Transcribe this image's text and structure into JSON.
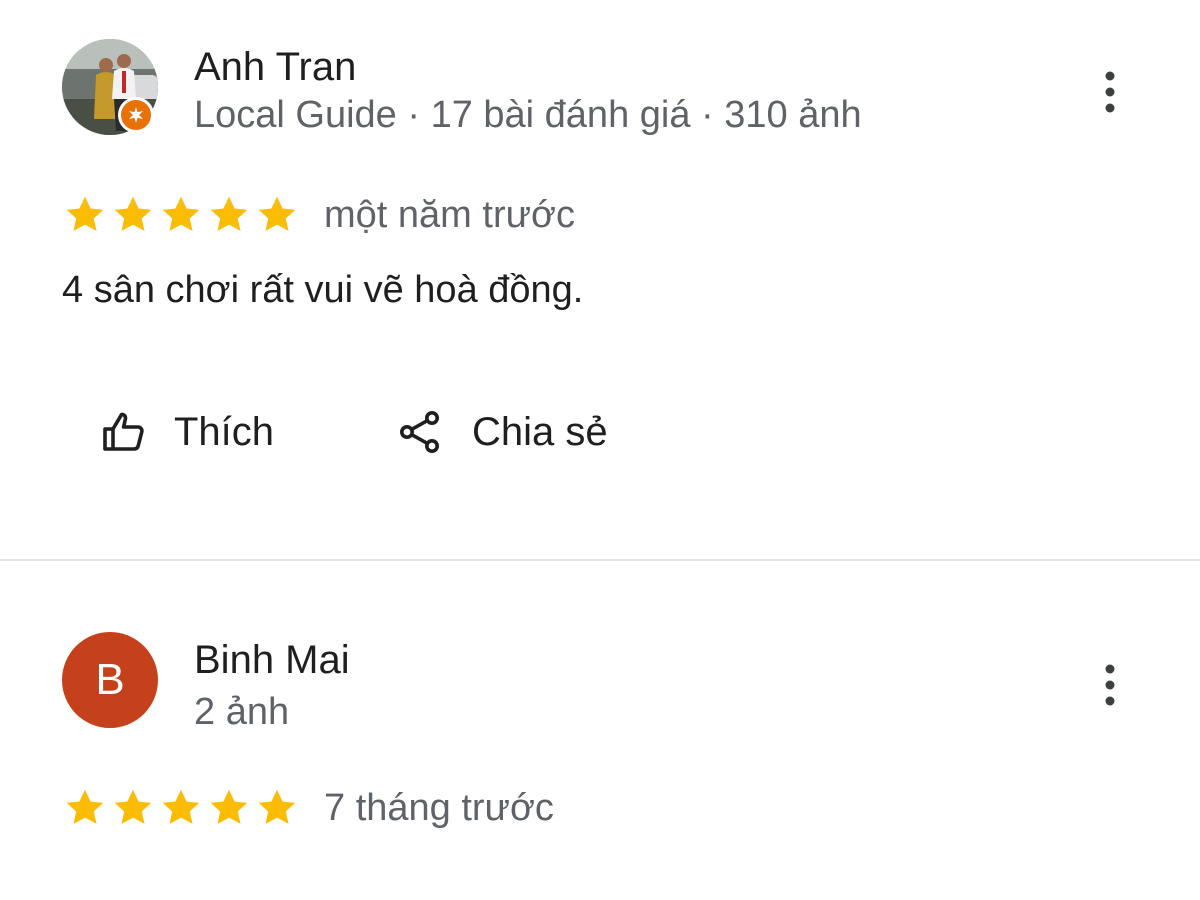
{
  "colors": {
    "star": "#fbbc04",
    "text_primary": "#1f1f1f",
    "text_secondary": "#5f6368",
    "divider": "#e3e3e3",
    "local_guide_badge": "#e8710a",
    "avatar_letter_bg": "#c5411b"
  },
  "reviews": [
    {
      "author": "Anh Tran",
      "author_meta": "Local Guide · 17 bài đánh giá · 310 ảnh",
      "avatar_type": "photo",
      "local_guide_badge": true,
      "rating": 5,
      "max_rating": 5,
      "date": "một năm trước",
      "text": "4 sân chơi rất vui vẽ hoà đồng.",
      "more_icon": "more-vert-icon",
      "actions": [
        {
          "label": "Thích",
          "icon": "thumb-up-icon"
        },
        {
          "label": "Chia sẻ",
          "icon": "share-icon"
        }
      ]
    },
    {
      "author": "Binh Mai",
      "author_meta": "2 ảnh",
      "avatar_type": "letter",
      "avatar_letter": "B",
      "rating": 5,
      "max_rating": 5,
      "date": "7 tháng trước",
      "more_icon": "more-vert-icon"
    }
  ]
}
